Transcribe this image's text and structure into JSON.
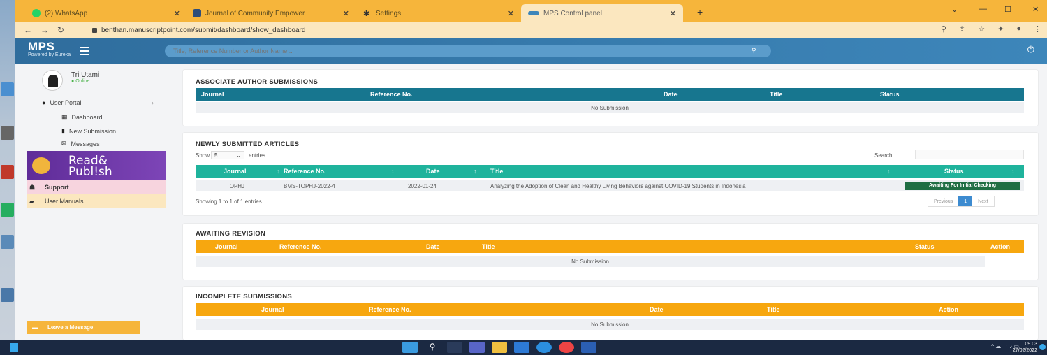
{
  "browser": {
    "tabs": [
      {
        "label": "(2) WhatsApp",
        "icon": "whatsapp-icon"
      },
      {
        "label": "Journal of Community Empower",
        "icon": "journal-icon"
      },
      {
        "label": "Settings",
        "icon": "gear-icon"
      },
      {
        "label": "MPS Control panel",
        "icon": "mps-icon"
      }
    ],
    "url": "benthan.manuscriptpoint.com/submit/dashboard/show_dashboard"
  },
  "header": {
    "brand": "MPS",
    "powered": "Powered by Eureka",
    "search_placeholder": "Title, Reference Number or Author Name..."
  },
  "sidebar": {
    "user_name": "Tri Utami",
    "user_status": "Online",
    "portal": "User Portal",
    "items": [
      "Dashboard",
      "New Submission",
      "Messages"
    ],
    "banner_line1": "Read&",
    "banner_line2": "Publ!sh",
    "support": "Support",
    "manuals": "User Manuals",
    "leave_message": "Leave a Message"
  },
  "panels": {
    "associate": {
      "title": "ASSOCIATE AUTHOR SUBMISSIONS",
      "columns": [
        "Journal",
        "Reference No.",
        "Date",
        "Title",
        "Status"
      ],
      "empty": "No Submission"
    },
    "newly": {
      "title": "NEWLY SUBMITTED ARTICLES",
      "show": "Show",
      "entries_value": "5",
      "entries": "entries",
      "search": "Search:",
      "columns": [
        "Journal",
        "Reference No.",
        "Date",
        "Title",
        "Status"
      ],
      "row": {
        "journal": "TOPHJ",
        "ref": "BMS-TOPHJ-2022-4",
        "date": "2022-01-24",
        "title": "Analyzing the Adoption of Clean and Healthy Living Behaviors against COVID-19 Students in Indonesia",
        "status": "Awaiting For Initial Checking"
      },
      "info": "Showing 1 to 1 of 1 entries",
      "pager": {
        "prev": "Previous",
        "page": "1",
        "next": "Next"
      }
    },
    "revision": {
      "title": "AWAITING REVISION",
      "columns": [
        "Journal",
        "Reference No.",
        "Date",
        "Title",
        "Status",
        "Action"
      ],
      "empty": "No Submission"
    },
    "incomplete": {
      "title": "INCOMPLETE SUBMISSIONS",
      "columns": [
        "Journal",
        "Reference No.",
        "Date",
        "Title",
        "Action"
      ],
      "empty": "No Submission"
    }
  },
  "taskbar": {
    "time": "09.03",
    "date": "27/02/2022"
  },
  "colors": {
    "tabbar": "#f6b53b",
    "header": "#3d86ba",
    "teal_header": "#17768f",
    "green_header": "#1fb39c",
    "amber_header": "#f7a70f",
    "badge": "#1f6e43"
  }
}
